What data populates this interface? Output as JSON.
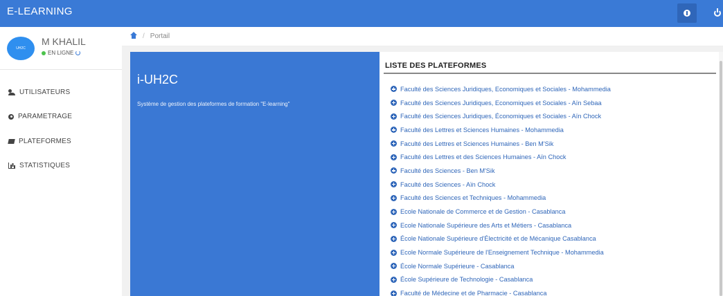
{
  "header": {
    "brand": "E-LEARNING"
  },
  "profile": {
    "avatar_text": "UH2C",
    "name": "M KHALIL",
    "status": "EN LIGNE"
  },
  "sidebar": {
    "items": [
      {
        "label": "UTILISATEURS",
        "icon": "users-icon"
      },
      {
        "label": "PARAMETRAGE",
        "icon": "gear-icon"
      },
      {
        "label": "PLATEFORMES",
        "icon": "book-icon"
      },
      {
        "label": "STATISTIQUES",
        "icon": "bar-chart-icon"
      }
    ]
  },
  "breadcrumb": {
    "current": "Portail"
  },
  "hero": {
    "title": "i-UH2C",
    "description": "Système de gestion des plateformes de formation \"E-learning\""
  },
  "platforms": {
    "title": "LISTE DES PLATEFORMES",
    "items": [
      "Faculté des Sciences Juridiques, Economiques et Sociales - Mohammedia",
      "Faculté des Sciences Juridiques, Economiques et Sociales - Aïn Sebaa",
      "Faculté des Sciences Juridiques, Économiques et Sociales - Aïn Chock",
      "Faculté des Lettres et Sciences Humaines - Mohammedia",
      "Faculté des Lettres et Sciences Humaines - Ben M'Sik",
      "Faculté des Lettres et des Sciences Humaines - Aïn Chock",
      "Faculté des Sciences - Ben M'Sik",
      "Faculté des Sciences - Aïn Chock",
      "Faculté des Sciences et Techniques - Mohammedia",
      "Ecole Nationale de Commerce et de Gestion - Casablanca",
      "Ecole Nationale Supérieure des Arts et Métiers - Casablanca",
      "École Nationale Supérieure d'Électricité et de Mécanique Casablanca",
      "Ecole Normale Supérieure de l'Enseignement Technique - Mohammedia",
      "École Normale Supérieure - Casablanca",
      "École Supérieure de Technologie - Casablanca",
      "Faculté de Médecine et de Pharmacie - Casablanca"
    ]
  },
  "colors": {
    "topbar": "#3a7ad6",
    "hero": "#3a78d4",
    "link": "#2f66b9",
    "online": "#4cc34c"
  }
}
